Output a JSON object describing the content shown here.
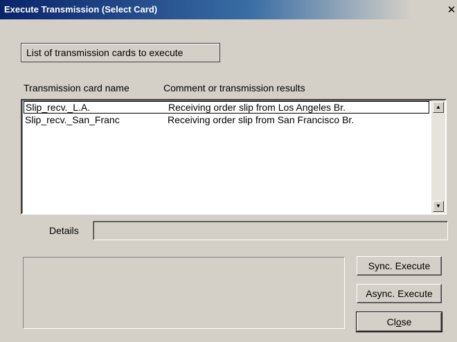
{
  "window": {
    "title": "Execute Transmission (Select Card)",
    "close_glyph": "✕"
  },
  "group": {
    "label": "List of transmission cards to execute"
  },
  "list": {
    "headers": {
      "name": "Transmission card name",
      "comment": "Comment or transmission results"
    },
    "rows": [
      {
        "name": "Slip_recv._L.A.",
        "comment": "Receiving order slip from Los Angeles Br.",
        "selected": true
      },
      {
        "name": "Slip_recv._San_Franc",
        "comment": "Receiving order slip from San Francisco Br.",
        "selected": false
      }
    ],
    "scroll_up_glyph": "▲",
    "scroll_down_glyph": "▼"
  },
  "details": {
    "label": "Details",
    "value": ""
  },
  "buttons": {
    "sync": "Sync. Execute",
    "async": "Async. Execute",
    "close_prefix": "Cl",
    "close_mnemonic": "o",
    "close_suffix": "se"
  },
  "icons": {
    "close": "close-icon",
    "scroll_up": "arrow-up-icon",
    "scroll_down": "arrow-down-icon"
  },
  "colors": {
    "title_active": "#0a246a",
    "dialog_face": "#d4d0c8"
  }
}
